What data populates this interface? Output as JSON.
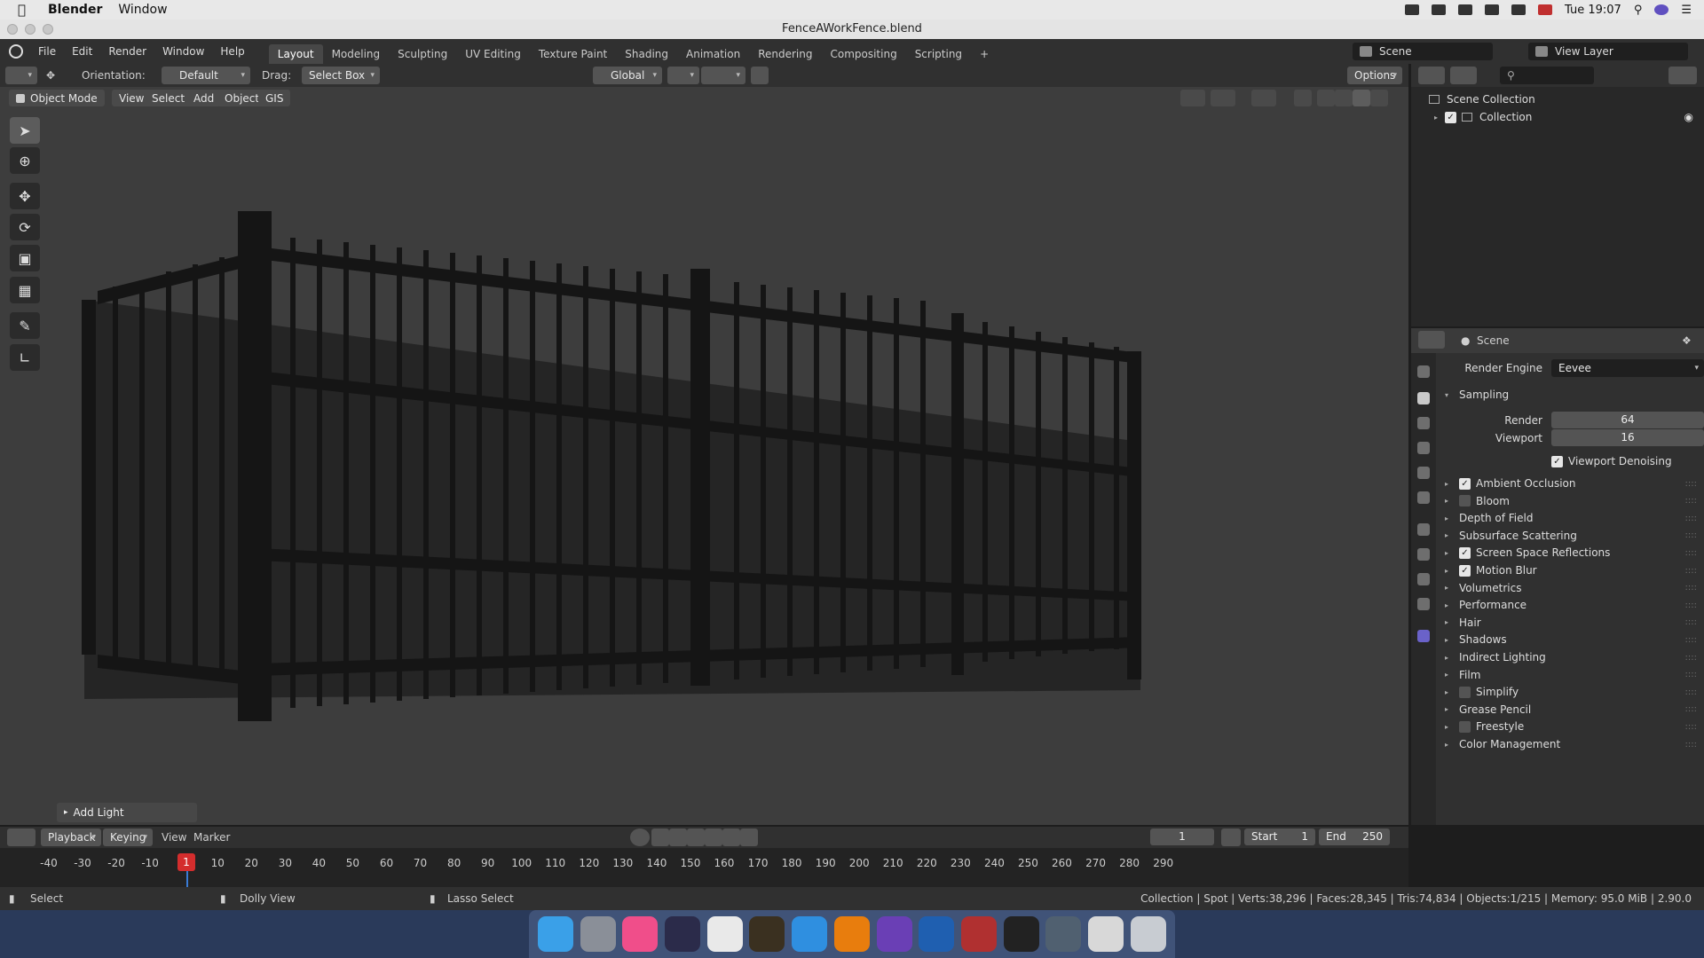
{
  "mac_menubar": {
    "app_name": "Blender",
    "menu_window": "Window",
    "clock": "Tue 19:07"
  },
  "window": {
    "title": "FenceAWorkFence.blend"
  },
  "menu": {
    "file": "File",
    "edit": "Edit",
    "render": "Render",
    "window": "Window",
    "help": "Help",
    "workspaces": [
      "Layout",
      "Modeling",
      "Sculpting",
      "UV Editing",
      "Texture Paint",
      "Shading",
      "Animation",
      "Rendering",
      "Compositing",
      "Scripting"
    ],
    "add_workspace": "+",
    "scene": "Scene",
    "view_layer": "View Layer"
  },
  "toolheader": {
    "orientation_label": "Orientation:",
    "orientation_value": "Default",
    "drag_label": "Drag:",
    "drag_value": "Select Box",
    "transform_orientation": "Global",
    "options": "Options"
  },
  "viewport": {
    "mode": "Object Mode",
    "view": "View",
    "select": "Select",
    "add": "Add",
    "object": "Object",
    "gis": "GIS",
    "last_operator": "Add Light"
  },
  "outliner": {
    "scene_collection": "Scene Collection",
    "collection": "Collection"
  },
  "properties": {
    "context": "Scene",
    "render_engine_label": "Render Engine",
    "render_engine_value": "Eevee",
    "sampling": "Sampling",
    "render_label": "Render",
    "render_value": "64",
    "viewport_label": "Viewport",
    "viewport_value": "16",
    "viewport_denoising": "Viewport Denoising",
    "panels": [
      {
        "label": "Ambient Occlusion",
        "checkbox": true,
        "checked": true
      },
      {
        "label": "Bloom",
        "checkbox": true,
        "checked": false
      },
      {
        "label": "Depth of Field",
        "checkbox": false,
        "checked": false
      },
      {
        "label": "Subsurface Scattering",
        "checkbox": false,
        "checked": false
      },
      {
        "label": "Screen Space Reflections",
        "checkbox": true,
        "checked": true
      },
      {
        "label": "Motion Blur",
        "checkbox": true,
        "checked": true
      },
      {
        "label": "Volumetrics",
        "checkbox": false,
        "checked": false
      },
      {
        "label": "Performance",
        "checkbox": false,
        "checked": false
      },
      {
        "label": "Hair",
        "checkbox": false,
        "checked": false
      },
      {
        "label": "Shadows",
        "checkbox": false,
        "checked": false
      },
      {
        "label": "Indirect Lighting",
        "checkbox": false,
        "checked": false
      },
      {
        "label": "Film",
        "checkbox": false,
        "checked": false
      },
      {
        "label": "Simplify",
        "checkbox": true,
        "checked": false
      },
      {
        "label": "Grease Pencil",
        "checkbox": false,
        "checked": false
      },
      {
        "label": "Freestyle",
        "checkbox": true,
        "checked": false
      },
      {
        "label": "Color Management",
        "checkbox": false,
        "checked": false
      }
    ]
  },
  "timeline": {
    "playback": "Playback",
    "keying": "Keying",
    "view": "View",
    "marker": "Marker",
    "current_frame": "1",
    "start_label": "Start",
    "start_value": "1",
    "end_label": "End",
    "end_value": "250",
    "playhead_frame": "1",
    "ticks": [
      "-40",
      "-30",
      "-20",
      "-10",
      "10",
      "20",
      "30",
      "40",
      "50",
      "60",
      "70",
      "80",
      "90",
      "100",
      "110",
      "120",
      "130",
      "140",
      "150",
      "160",
      "170",
      "180",
      "190",
      "200",
      "210",
      "220",
      "230",
      "240",
      "250",
      "260",
      "270",
      "280",
      "290"
    ]
  },
  "statusbar": {
    "select": "Select",
    "dolly": "Dolly View",
    "lasso": "Lasso Select",
    "stats": "Collection | Spot | Verts:38,296 | Faces:28,345 | Tris:74,834 | Objects:1/215 | Memory: 95.0 MiB | 2.90.0"
  },
  "colors": {
    "accent_blue": "#3a7bd5",
    "playhead_red": "#d42d2d",
    "viewport_bg": "#3d3d3d"
  }
}
